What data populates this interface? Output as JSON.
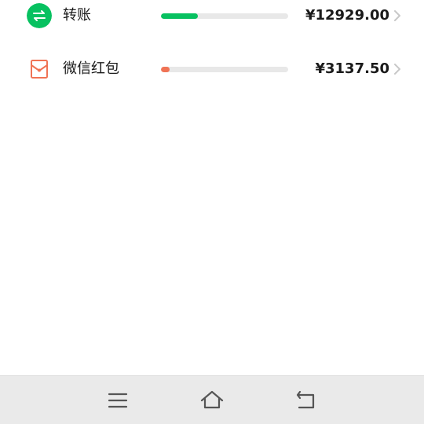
{
  "categories": [
    {
      "id": "transfer",
      "label": "转账",
      "amount": "¥12929.00",
      "share": 0.29,
      "color": "#07c160",
      "icon": "transfer-arrows-icon"
    },
    {
      "id": "red_packet",
      "label": "微信红包",
      "amount": "¥3137.50",
      "share": 0.07,
      "color": "#f07355",
      "icon": "red-packet-icon"
    }
  ],
  "navbar": {
    "menu_icon": "menu-icon",
    "home_icon": "home-icon",
    "back_icon": "back-icon",
    "background": "#eaeaea"
  }
}
